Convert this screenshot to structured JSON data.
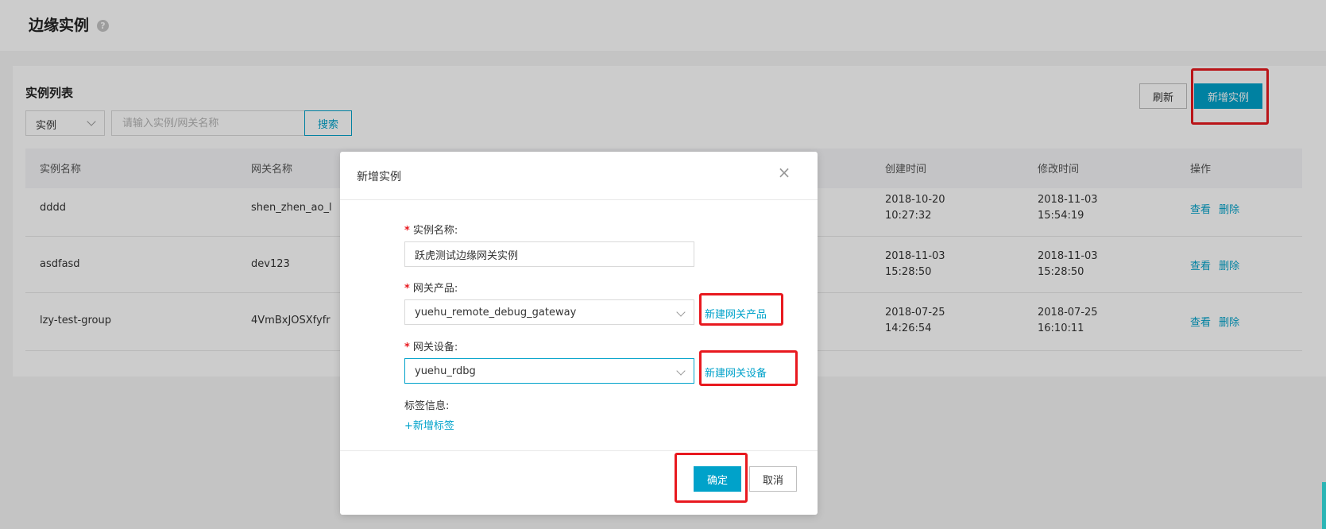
{
  "header": {
    "title": "边缘实例",
    "help_icon": "?"
  },
  "list": {
    "title": "实例列表",
    "filter_select": "实例",
    "search_placeholder": "请输入实例/网关名称",
    "search_label": "搜索",
    "refresh_label": "刷新",
    "add_label": "新增实例"
  },
  "table": {
    "columns": {
      "name": "实例名称",
      "gateway": "网关名称",
      "created": "创建时间",
      "modified": "修改时间",
      "ops": "操作"
    },
    "rows": [
      {
        "name": "dddd",
        "gateway": "shen_zhen_ao_l",
        "created_date": "2018-10-20",
        "created_time": "10:27:32",
        "modified_date": "2018-11-03",
        "modified_time": "15:54:19"
      },
      {
        "name": "asdfasd",
        "gateway": "dev123",
        "created_date": "2018-11-03",
        "created_time": "15:28:50",
        "modified_date": "2018-11-03",
        "modified_time": "15:28:50"
      },
      {
        "name": "lzy-test-group",
        "gateway": "4VmBxJOSXfyfr",
        "created_date": "2018-07-25",
        "created_time": "14:26:54",
        "modified_date": "2018-07-25",
        "modified_time": "16:10:11"
      }
    ],
    "view_label": "查看",
    "delete_label": "删除"
  },
  "modal": {
    "title": "新增实例",
    "close_icon": "×",
    "name_label": "实例名称:",
    "name_value": "跃虎测试边缘网关实例",
    "product_label": "网关产品:",
    "product_value": "yuehu_remote_debug_gateway",
    "new_product_link": "新建网关产品",
    "device_label": "网关设备:",
    "device_value": "yuehu_rdbg",
    "new_device_link": "新建网关设备",
    "tag_label": "标签信息:",
    "add_tag_link": "+新增标签",
    "confirm_label": "确定",
    "cancel_label": "取消",
    "required_mark": "*"
  },
  "colors": {
    "accent": "#00a2ca",
    "highlight": "#e8191f"
  }
}
